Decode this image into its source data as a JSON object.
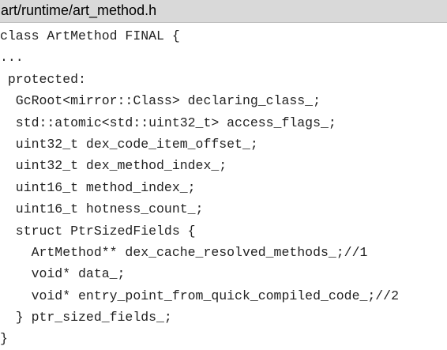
{
  "file": {
    "path": "art/runtime/art_method.h"
  },
  "code": {
    "lines": [
      "class ArtMethod FINAL {",
      "...",
      " protected:",
      "  GcRoot<mirror::Class> declaring_class_;",
      "  std::atomic<std::uint32_t> access_flags_;",
      "  uint32_t dex_code_item_offset_;",
      "  uint32_t dex_method_index_;",
      "  uint16_t method_index_;",
      "  uint16_t hotness_count_;",
      "  struct PtrSizedFields {",
      "    ArtMethod** dex_cache_resolved_methods_;//1",
      "    void* data_;",
      "    void* entry_point_from_quick_compiled_code_;//2",
      "  } ptr_sized_fields_;",
      "}"
    ]
  }
}
